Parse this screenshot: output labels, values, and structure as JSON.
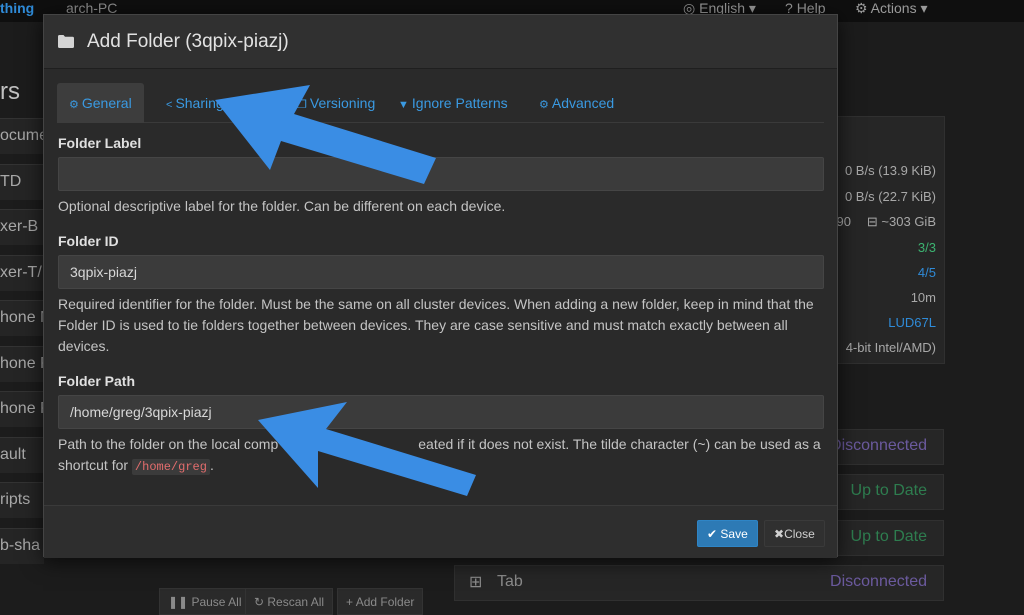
{
  "navbar": {
    "brand": "thing",
    "device_name": "arch-PC",
    "language": "English",
    "help": "Help",
    "actions": "Actions"
  },
  "background": {
    "heading": "rs",
    "folders": [
      "ocume",
      "TD",
      "xer-B",
      "xer-T/",
      "hone M",
      "hone P",
      "hone P",
      "ault",
      "ripts",
      "b-sha"
    ],
    "stats": [
      "0 B/s (13.9 KiB)",
      "0 B/s (22.7 KiB)",
      "90",
      "~303 GiB",
      "3/3",
      "4/5",
      "10m",
      "LUD67L",
      "4-bit Intel/AMD)"
    ],
    "devices": [
      {
        "name": "",
        "status": "Disconnected"
      },
      {
        "name": "",
        "status": "Up to Date"
      },
      {
        "name": "",
        "status": "Up to Date"
      },
      {
        "name": "Tab",
        "status": "Disconnected"
      }
    ],
    "buttons": {
      "pause_all": "Pause All",
      "rescan_all": "Rescan All",
      "add_folder": "Add Folder"
    }
  },
  "modal": {
    "title": "Add Folder (3qpix-piazj)",
    "tabs": [
      {
        "label": "General",
        "icon": "gear-icon"
      },
      {
        "label": "Sharing",
        "icon": "share-icon"
      },
      {
        "label": "Versioning",
        "icon": "copy-icon"
      },
      {
        "label": "Ignore Patterns",
        "icon": "filter-icon"
      },
      {
        "label": "Advanced",
        "icon": "cogs-icon"
      }
    ],
    "folder_label": {
      "label": "Folder Label",
      "value": "",
      "help": "Optional descriptive label for the folder. Can be different on each device."
    },
    "folder_id": {
      "label": "Folder ID",
      "value": "3qpix-piazj",
      "help": "Required identifier for the folder. Must be the same on all cluster devices. When adding a new folder, keep in mind that the Folder ID is used to tie folders together between devices. They are case sensitive and must match exactly between all devices."
    },
    "folder_path": {
      "label": "Folder Path",
      "value": "/home/greg/3qpix-piazj",
      "help_before": "Path to the folder on the local comp",
      "help_middle": "eated if it does not exist. The tilde character (~) can be used as a shortcut for",
      "help_code": "/home/greg",
      "help_after": "."
    },
    "save_label": "Save",
    "close_label": "Close"
  },
  "colors": {
    "accent": "#3a9ae2",
    "arrow": "#3a8de4",
    "save_button": "#2d7ab5"
  }
}
